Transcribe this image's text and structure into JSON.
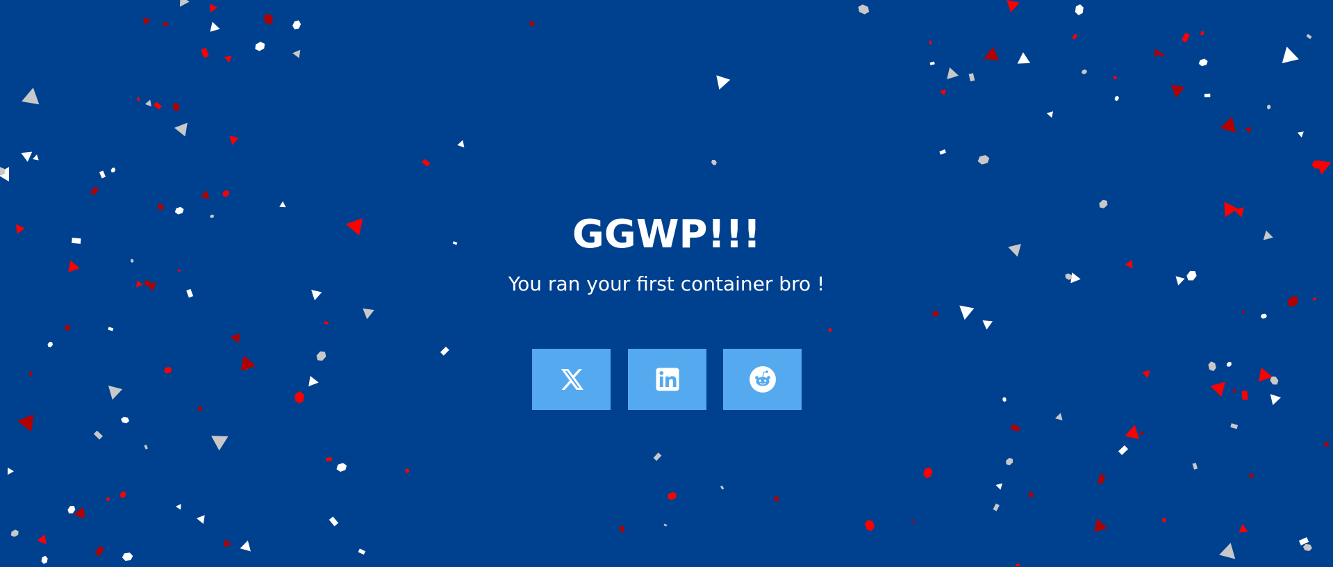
{
  "page": {
    "title": "GGWP!!!",
    "subtitle": "You ran your first container bro !"
  },
  "share_buttons": [
    {
      "icon": "x-icon",
      "label": ""
    },
    {
      "icon": "linkedin-icon",
      "label": ""
    },
    {
      "icon": "reddit-icon",
      "label": ""
    }
  ],
  "colors": {
    "background": "#00418f",
    "button": "#55a9ee",
    "text": "#ffffff",
    "confetti": [
      "#ffffff",
      "#c8c8c8",
      "#ff0000",
      "#b00000"
    ]
  }
}
